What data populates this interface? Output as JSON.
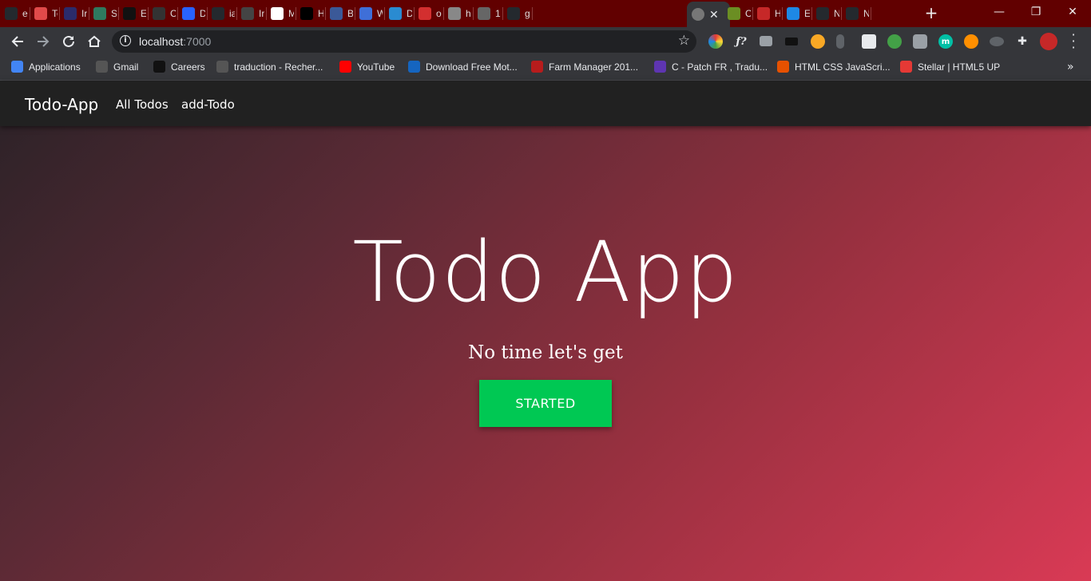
{
  "browser": {
    "tabs": [
      {
        "label": "ex",
        "icon": "github-icon",
        "color": "#24292e"
      },
      {
        "label": "To",
        "icon": "todo-icon",
        "color": "#e04a4a"
      },
      {
        "label": "Ir",
        "icon": "generic-icon",
        "color": "#2b2b6b"
      },
      {
        "label": "Sı",
        "icon": "generic-icon",
        "color": "#2f7a5f"
      },
      {
        "label": "Ex",
        "icon": "ex-icon",
        "color": "#111111"
      },
      {
        "label": "C",
        "icon": "generic-icon",
        "color": "#333333"
      },
      {
        "label": "D",
        "icon": "c-icon",
        "color": "#2962ff"
      },
      {
        "label": "ia",
        "icon": "github-icon",
        "color": "#24292e"
      },
      {
        "label": "Ir",
        "icon": "link-icon",
        "color": "#444444"
      },
      {
        "label": "M",
        "icon": "m-icon",
        "color": "#ffffff"
      },
      {
        "label": "H",
        "icon": "medium-icon",
        "color": "#000000"
      },
      {
        "label": "B",
        "icon": "mdb-icon",
        "color": "#3b5998"
      },
      {
        "label": "W",
        "icon": "generic-icon",
        "color": "#3f6fd8"
      },
      {
        "label": "D",
        "icon": "generic-icon",
        "color": "#2a8bd1"
      },
      {
        "label": "o",
        "icon": "n-icon",
        "color": "#d32f2f"
      },
      {
        "label": "h",
        "icon": "generic-icon",
        "color": "#888888"
      },
      {
        "label": "1",
        "icon": "globe-icon",
        "color": "#666666"
      },
      {
        "label": "g",
        "icon": "github-icon",
        "color": "#24292e"
      }
    ],
    "active_tab_close": "✕",
    "tabs_after": [
      {
        "label": "C",
        "icon": "generic-icon",
        "color": "#6b8e23"
      },
      {
        "label": "H",
        "icon": "z-icon",
        "color": "#c62828"
      },
      {
        "label": "E",
        "icon": "flag-icon",
        "color": "#1e88e5"
      },
      {
        "label": "N",
        "icon": "github-icon",
        "color": "#24292e"
      },
      {
        "label": "N",
        "icon": "github-icon",
        "color": "#24292e"
      }
    ],
    "new_tab": "+",
    "window_controls": {
      "minimize": "—",
      "restore": "❐",
      "close": "✕"
    },
    "address": {
      "host": "localhost",
      "port": ":7000"
    },
    "bookmarks": [
      {
        "label": "Applications",
        "icon": "apps-icon",
        "color": "#4285f4"
      },
      {
        "label": "Gmail",
        "icon": "globe-icon",
        "color": "#555555"
      },
      {
        "label": "Careers",
        "icon": "angular-icon",
        "color": "#111111"
      },
      {
        "label": "traduction - Recher...",
        "icon": "globe-icon",
        "color": "#555555"
      },
      {
        "label": "YouTube",
        "icon": "youtube-icon",
        "color": "#ff0000"
      },
      {
        "label": "Download Free Mot...",
        "icon": "v-icon",
        "color": "#1565c0"
      },
      {
        "label": "Farm Manager 201...",
        "icon": "farm-icon",
        "color": "#b71c1c"
      },
      {
        "label": "C - Patch FR , Tradu...",
        "icon": "patch-icon",
        "color": "#5e35b1"
      },
      {
        "label": "HTML CSS JavaScri...",
        "icon": "html-icon",
        "color": "#e65100"
      },
      {
        "label": "Stellar | HTML5 UP",
        "icon": "html5up-icon",
        "color": "#e53935"
      }
    ],
    "bookmarks_more": "»"
  },
  "app": {
    "brand": "Todo-App",
    "nav": [
      {
        "label": "All Todos"
      },
      {
        "label": "add-Todo"
      }
    ],
    "hero": {
      "title": "Todo App",
      "subtitle": "No time let's get",
      "cta_label": "STARTED"
    },
    "colors": {
      "navbar": "#212121",
      "cta": "#00c853",
      "gradient_start": "#2a2227",
      "gradient_end": "#d93a55"
    }
  }
}
